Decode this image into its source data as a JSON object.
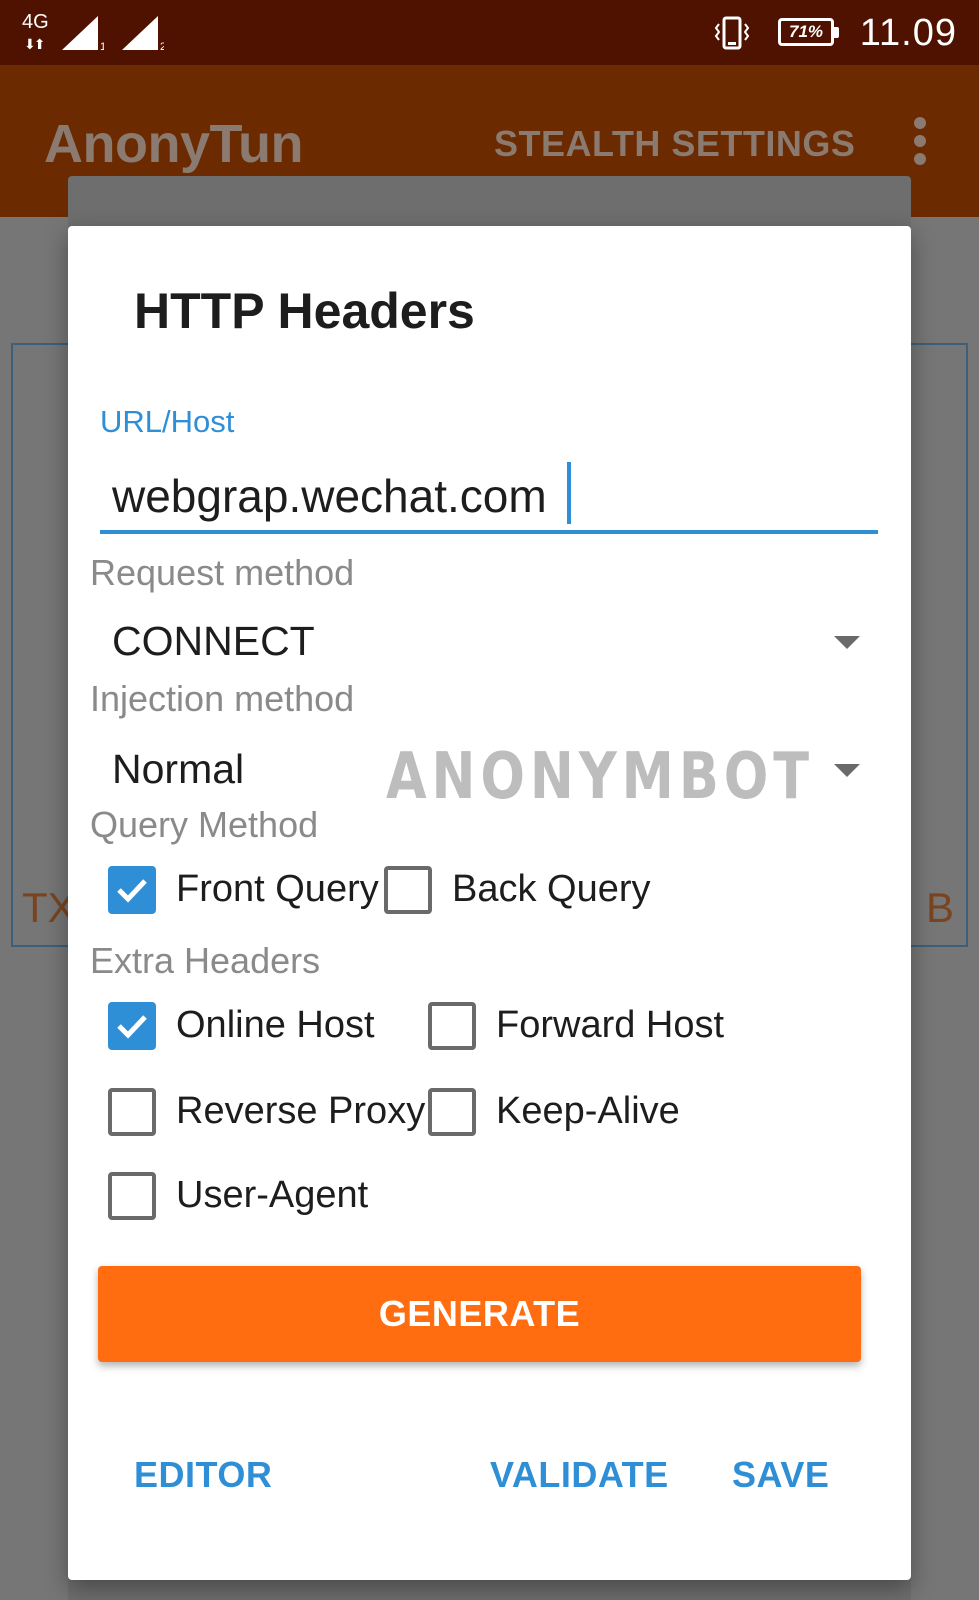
{
  "status_bar": {
    "network": "4G",
    "network_arrows": "⬇⬆",
    "sim1": "1",
    "sim2": "2",
    "battery": "71%",
    "time": "11.09"
  },
  "app_bar": {
    "title": "AnonyTun",
    "action": "STEALTH SETTINGS",
    "overflow_icon": "more-vert-icon"
  },
  "background": {
    "left_text": "TX",
    "right_text": "B"
  },
  "dialog": {
    "title": "HTTP Headers",
    "url_label": "URL/Host",
    "url_value": "webgrap.wechat.com",
    "request_method_label": "Request method",
    "request_method_value": "CONNECT",
    "injection_method_label": "Injection method",
    "injection_method_value": "Normal",
    "watermark": "ANONYMBOT",
    "query_method_label": "Query Method",
    "query_options": [
      {
        "label": "Front Query",
        "checked": true
      },
      {
        "label": "Back Query",
        "checked": false
      }
    ],
    "extra_headers_label": "Extra Headers",
    "extra_headers": [
      {
        "label": "Online Host",
        "checked": true
      },
      {
        "label": "Forward Host",
        "checked": false
      },
      {
        "label": "Reverse Proxy",
        "checked": false
      },
      {
        "label": "Keep-Alive",
        "checked": false
      },
      {
        "label": "User-Agent",
        "checked": false
      }
    ],
    "generate_label": "GENERATE",
    "editor_label": "EDITOR",
    "validate_label": "VALIDATE",
    "save_label": "SAVE"
  },
  "colors": {
    "accent": "#2f8fd6",
    "primary": "#ff6d10",
    "status_bar": "#4f1200"
  }
}
